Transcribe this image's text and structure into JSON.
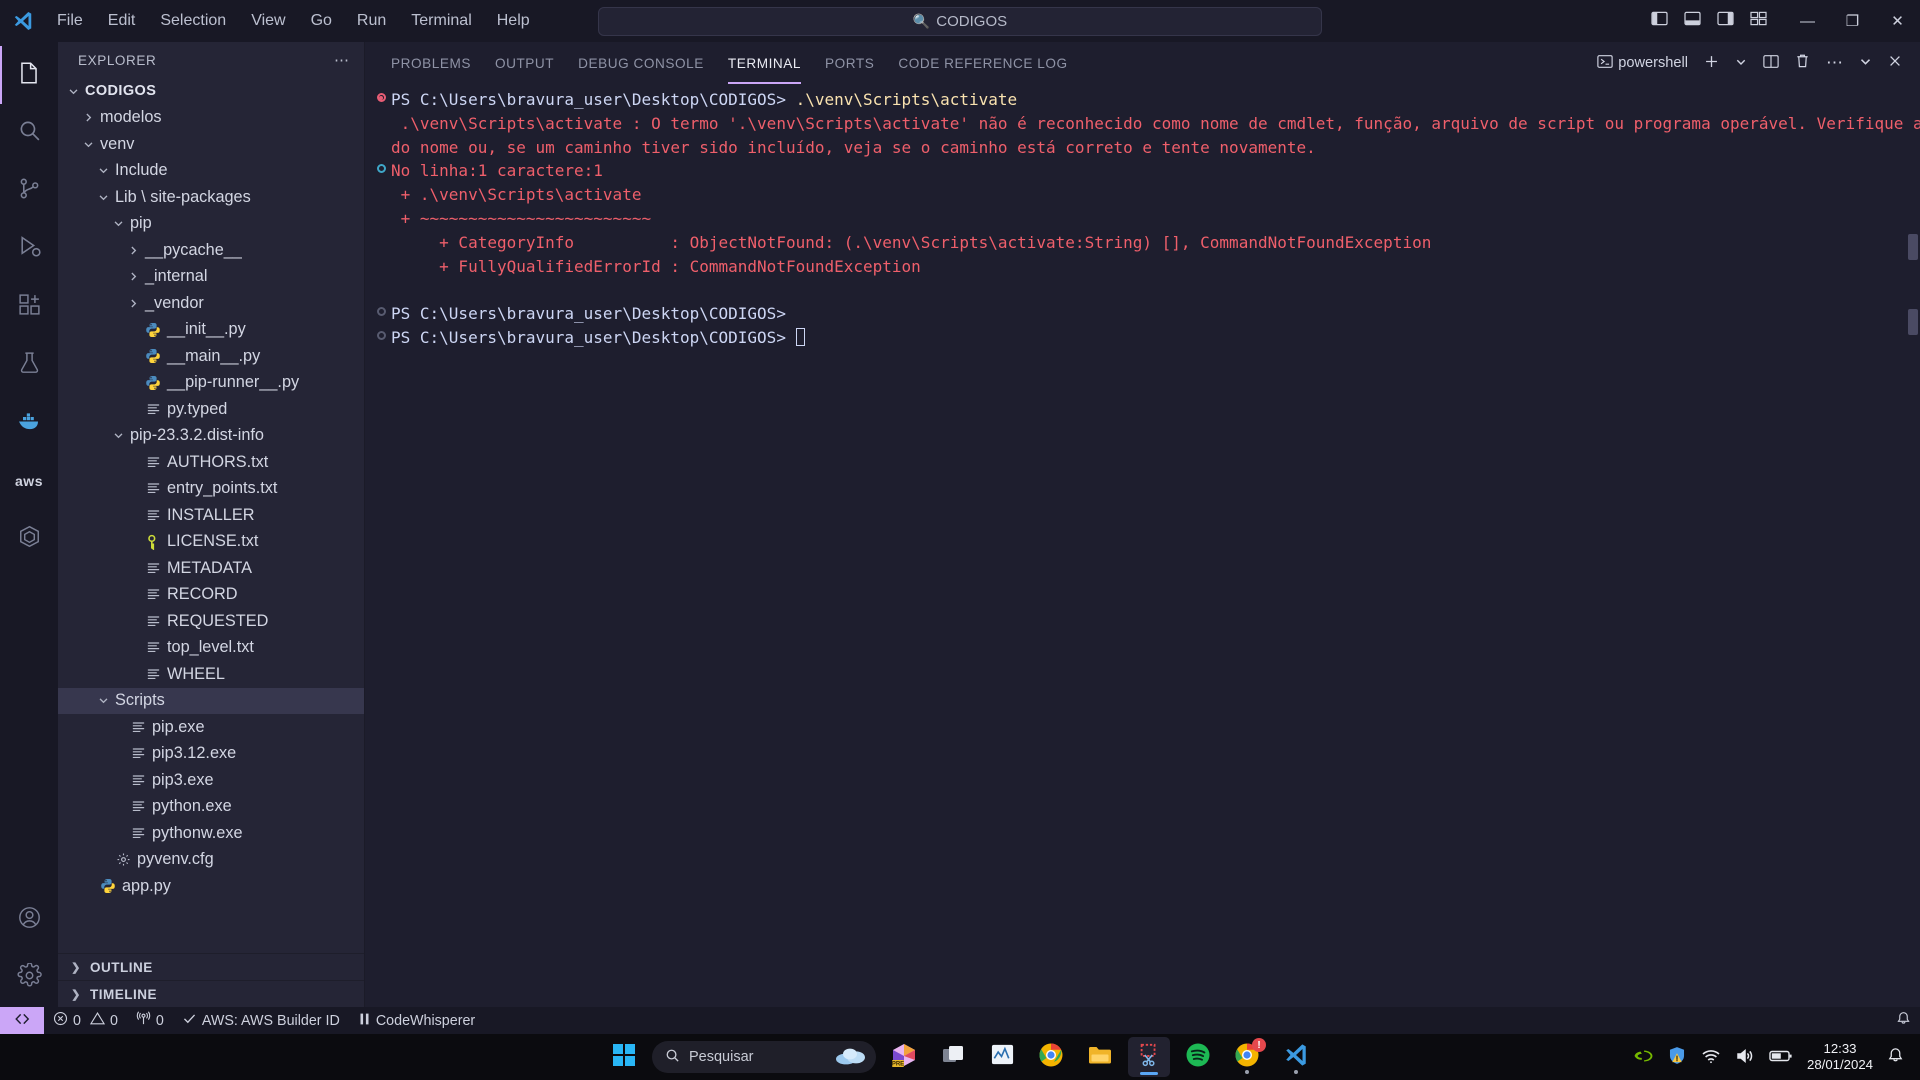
{
  "titlebar": {
    "menu": [
      "File",
      "Edit",
      "Selection",
      "View",
      "Go",
      "Run",
      "Terminal",
      "Help"
    ],
    "command_center_text": "CODIGOS",
    "search_icon": "search-icon",
    "back_icon": "arrow-left-icon",
    "forward_icon": "arrow-right-icon",
    "layout_icons": [
      "toggle-primary-sidebar-icon",
      "toggle-panel-icon",
      "toggle-secondary-sidebar-icon",
      "customize-layout-icon"
    ],
    "minimize": "—",
    "maximize": "❐",
    "close": "✕"
  },
  "activitybar": {
    "items": [
      {
        "name": "explorer",
        "icon": "files-icon",
        "active": true
      },
      {
        "name": "search",
        "icon": "search-icon",
        "active": false
      },
      {
        "name": "source-control",
        "icon": "source-control-icon",
        "active": false
      },
      {
        "name": "run-and-debug",
        "icon": "debug-icon",
        "active": false
      },
      {
        "name": "extensions",
        "icon": "extensions-icon",
        "active": false
      },
      {
        "name": "testing",
        "icon": "beaker-icon",
        "active": false
      },
      {
        "name": "docker",
        "icon": "docker-whale-icon",
        "active": false
      },
      {
        "name": "aws-toolkit",
        "icon": "aws-icon",
        "active": false
      },
      {
        "name": "codewhisperer",
        "icon": "hexagon-icon",
        "active": false
      }
    ],
    "bottom": [
      {
        "name": "accounts",
        "icon": "account-icon"
      },
      {
        "name": "manage",
        "icon": "gear-icon"
      }
    ]
  },
  "sidebar": {
    "title": "EXPLORER",
    "more_actions": "⋯",
    "root": {
      "label": "CODIGOS",
      "expanded": true
    },
    "tree": [
      {
        "label": "modelos",
        "indent": 1,
        "type": "folder",
        "state": "collapsed"
      },
      {
        "label": "venv",
        "indent": 1,
        "type": "folder",
        "state": "expanded"
      },
      {
        "label": "Include",
        "indent": 2,
        "type": "folder",
        "state": "expanded"
      },
      {
        "label": "Lib \\ site-packages",
        "indent": 2,
        "type": "folder",
        "state": "expanded"
      },
      {
        "label": "pip",
        "indent": 3,
        "type": "folder",
        "state": "expanded"
      },
      {
        "label": "__pycache__",
        "indent": 4,
        "type": "folder",
        "state": "collapsed"
      },
      {
        "label": "_internal",
        "indent": 4,
        "type": "folder",
        "state": "collapsed"
      },
      {
        "label": "_vendor",
        "indent": 4,
        "type": "folder",
        "state": "collapsed"
      },
      {
        "label": "__init__.py",
        "indent": 4,
        "type": "python"
      },
      {
        "label": "__main__.py",
        "indent": 4,
        "type": "python"
      },
      {
        "label": "__pip-runner__.py",
        "indent": 4,
        "type": "python"
      },
      {
        "label": "py.typed",
        "indent": 4,
        "type": "text"
      },
      {
        "label": "pip-23.3.2.dist-info",
        "indent": 3,
        "type": "folder",
        "state": "expanded"
      },
      {
        "label": "AUTHORS.txt",
        "indent": 4,
        "type": "text"
      },
      {
        "label": "entry_points.txt",
        "indent": 4,
        "type": "text"
      },
      {
        "label": "INSTALLER",
        "indent": 4,
        "type": "text"
      },
      {
        "label": "LICENSE.txt",
        "indent": 4,
        "type": "license"
      },
      {
        "label": "METADATA",
        "indent": 4,
        "type": "text"
      },
      {
        "label": "RECORD",
        "indent": 4,
        "type": "text"
      },
      {
        "label": "REQUESTED",
        "indent": 4,
        "type": "text"
      },
      {
        "label": "top_level.txt",
        "indent": 4,
        "type": "text"
      },
      {
        "label": "WHEEL",
        "indent": 4,
        "type": "text"
      },
      {
        "label": "Scripts",
        "indent": 2,
        "type": "folder",
        "state": "expanded",
        "selected": true
      },
      {
        "label": "pip.exe",
        "indent": 3,
        "type": "text"
      },
      {
        "label": "pip3.12.exe",
        "indent": 3,
        "type": "text"
      },
      {
        "label": "pip3.exe",
        "indent": 3,
        "type": "text"
      },
      {
        "label": "python.exe",
        "indent": 3,
        "type": "text"
      },
      {
        "label": "pythonw.exe",
        "indent": 3,
        "type": "text"
      },
      {
        "label": "pyvenv.cfg",
        "indent": 2,
        "type": "config"
      },
      {
        "label": "app.py",
        "indent": 1,
        "type": "python"
      }
    ],
    "sections": [
      {
        "label": "OUTLINE",
        "state": "collapsed"
      },
      {
        "label": "TIMELINE",
        "state": "collapsed"
      }
    ]
  },
  "panel": {
    "tabs": [
      {
        "label": "PROBLEMS",
        "active": false
      },
      {
        "label": "OUTPUT",
        "active": false
      },
      {
        "label": "DEBUG CONSOLE",
        "active": false
      },
      {
        "label": "TERMINAL",
        "active": true
      },
      {
        "label": "PORTS",
        "active": false
      },
      {
        "label": "CODE REFERENCE LOG",
        "active": false
      }
    ],
    "shell_label": "powershell",
    "shell_icon": "terminal-powershell-icon",
    "actions": [
      {
        "name": "new-terminal",
        "icon": "plus-icon"
      },
      {
        "name": "terminal-dropdown",
        "icon": "chevron-down-icon"
      },
      {
        "name": "split-terminal",
        "icon": "split-icon"
      },
      {
        "name": "kill-terminal",
        "icon": "trash-icon"
      },
      {
        "name": "panel-more",
        "icon": "ellipsis-icon"
      },
      {
        "name": "hide-panel",
        "icon": "chevron-down-icon"
      },
      {
        "name": "close-panel",
        "icon": "close-icon"
      }
    ],
    "accent_color": "#cba6f7"
  },
  "terminal": {
    "lines": [
      {
        "gutter": "err",
        "segments": [
          {
            "text": "PS C:\\Users\\bravura_user\\Desktop\\CODIGOS> ",
            "style": "prompt"
          },
          {
            "text": ".\\venv\\Scripts\\activate",
            "style": "cmd"
          }
        ]
      },
      {
        "gutter": "",
        "segments": [
          {
            "text": " .\\venv\\Scripts\\activate : O termo '.\\venv\\Scripts\\activate' não é reconhecido como nome de cmdlet, função, arquivo de script ou programa operável. Verifique a grafia",
            "style": "err"
          }
        ]
      },
      {
        "gutter": "",
        "segments": [
          {
            "text": "do nome ou, se um caminho tiver sido incluído, veja se o caminho está correto e tente novamente.",
            "style": "err"
          }
        ]
      },
      {
        "gutter": "info",
        "segments": [
          {
            "text": "No linha:1 caractere:1",
            "style": "err"
          }
        ]
      },
      {
        "gutter": "",
        "segments": [
          {
            "text": " + .\\venv\\Scripts\\activate",
            "style": "err"
          }
        ]
      },
      {
        "gutter": "",
        "segments": [
          {
            "text": " + ~~~~~~~~~~~~~~~~~~~~~~~~",
            "style": "err"
          }
        ]
      },
      {
        "gutter": "",
        "segments": [
          {
            "text": "     + CategoryInfo          : ObjectNotFound: (.\\venv\\Scripts\\activate:String) [], CommandNotFoundException",
            "style": "err"
          }
        ]
      },
      {
        "gutter": "",
        "segments": [
          {
            "text": "     + FullyQualifiedErrorId : CommandNotFoundException",
            "style": "err"
          }
        ]
      },
      {
        "gutter": "",
        "segments": [
          {
            "text": " ",
            "style": "prompt"
          }
        ]
      },
      {
        "gutter": "ok",
        "segments": [
          {
            "text": "PS C:\\Users\\bravura_user\\Desktop\\CODIGOS>",
            "style": "prompt"
          }
        ]
      },
      {
        "gutter": "ok",
        "segments": [
          {
            "text": "PS C:\\Users\\bravura_user\\Desktop\\CODIGOS> ",
            "style": "prompt"
          },
          {
            "text": "",
            "style": "caret"
          }
        ]
      }
    ]
  },
  "statusbar": {
    "remote_icon": "remote-window-icon",
    "errors_icon": "error-circle-icon",
    "errors": "0",
    "warnings_icon": "warning-triangle-icon",
    "warnings": "0",
    "radio_icon": "radio-tower-icon",
    "radio_count": "0",
    "aws_check_icon": "check-icon",
    "aws_label": "AWS: AWS Builder ID",
    "codewhisperer_icon": "pause-icon",
    "codewhisperer_label": "CodeWhisperer",
    "notifications_icon": "bell-icon"
  },
  "taskbar": {
    "start_icon": "windows-start-icon",
    "search_placeholder": "Pesquisar",
    "search_icon": "search-icon",
    "weather_icon": "cloud-icon",
    "apps": [
      {
        "name": "copilot-pre",
        "icon": "copilot-icon",
        "running": false
      },
      {
        "name": "task-view",
        "icon": "task-view-icon",
        "running": false
      },
      {
        "name": "performance-monitor",
        "icon": "chart-icon",
        "running": false
      },
      {
        "name": "google-chrome",
        "icon": "chrome-icon",
        "running": false
      },
      {
        "name": "file-explorer",
        "icon": "folder-icon",
        "running": false
      },
      {
        "name": "snipping-tool",
        "icon": "snipping-tool-icon",
        "running": true,
        "active": true
      },
      {
        "name": "spotify",
        "icon": "spotify-icon",
        "running": false
      },
      {
        "name": "chrome-window",
        "icon": "chrome-icon",
        "running": true,
        "badge": "!"
      },
      {
        "name": "visual-studio-code",
        "icon": "vscode-icon",
        "running": true
      }
    ],
    "tray": [
      {
        "name": "nvidia",
        "icon": "nvidia-icon"
      },
      {
        "name": "windows-security",
        "icon": "shield-warning-icon"
      },
      {
        "name": "network",
        "icon": "wifi-icon"
      },
      {
        "name": "volume",
        "icon": "speaker-icon"
      },
      {
        "name": "battery",
        "icon": "battery-icon"
      }
    ],
    "time": "12:33",
    "date": "28/01/2024",
    "notification_icon": "bell-icon"
  }
}
